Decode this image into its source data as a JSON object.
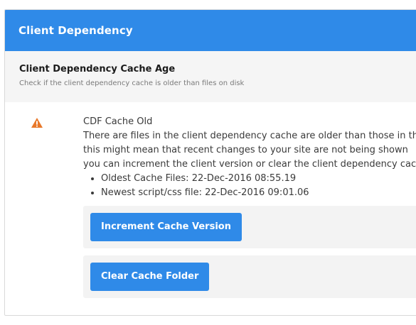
{
  "header": {
    "title": "Client Dependency"
  },
  "section": {
    "title": "Client Dependency Cache Age",
    "description": "Check if the client dependency cache is older than files on disk"
  },
  "check": {
    "status_icon": "warning-icon",
    "status_color": "#e8782a",
    "title": "CDF Cache Old",
    "lines": [
      "There are files in the client dependency cache are older than those in the",
      "this might mean that recent changes to your site are not being shown",
      "you can increment the client version or clear the client dependency cach"
    ],
    "bullets": [
      "Oldest Cache Files: 22-Dec-2016 08:55.19",
      "Newest script/css file: 22-Dec-2016 09:01.06"
    ]
  },
  "actions": {
    "increment_label": "Increment Cache Version",
    "clear_label": "Clear Cache Folder"
  },
  "colors": {
    "accent": "#2f8ae8",
    "warning": "#e8782a"
  }
}
